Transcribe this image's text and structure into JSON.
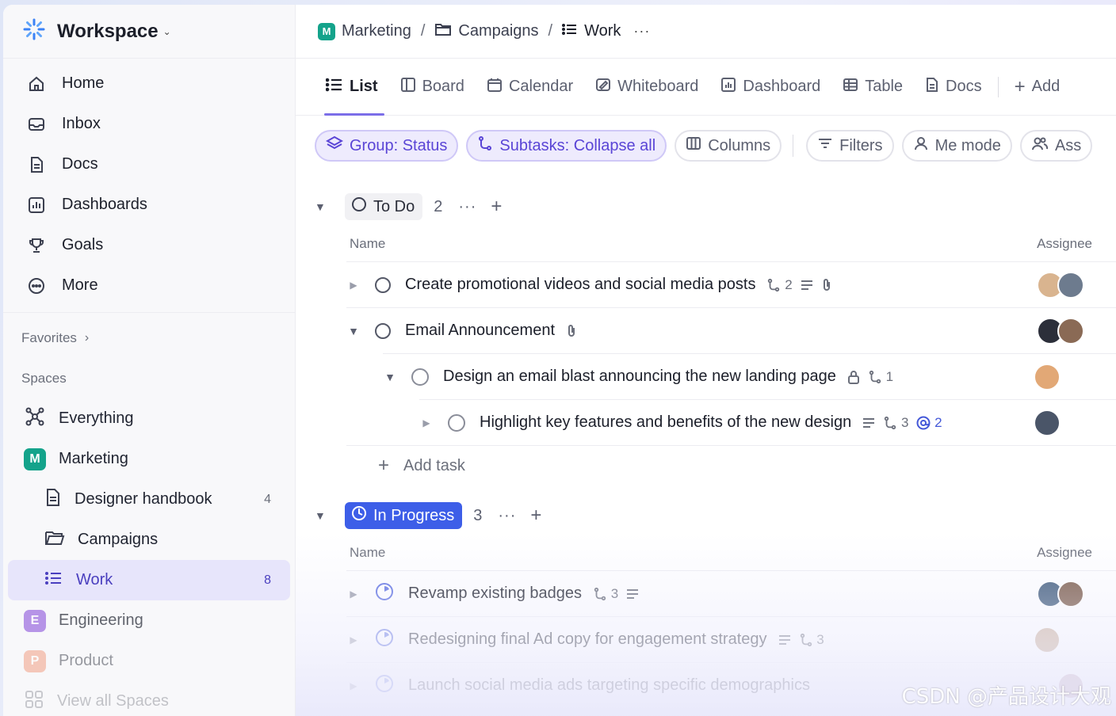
{
  "workspace": {
    "title": "Workspace"
  },
  "nav": [
    {
      "label": "Home",
      "icon": "home-icon"
    },
    {
      "label": "Inbox",
      "icon": "inbox-icon"
    },
    {
      "label": "Docs",
      "icon": "docs-icon"
    },
    {
      "label": "Dashboards",
      "icon": "dashboards-icon"
    },
    {
      "label": "Goals",
      "icon": "trophy-icon"
    },
    {
      "label": "More",
      "icon": "more-icon"
    }
  ],
  "sections": {
    "favorites": "Favorites",
    "spaces": "Spaces"
  },
  "spaces": {
    "everything": "Everything",
    "marketing": {
      "badge": "M",
      "label": "Marketing",
      "color": "#14a38b"
    },
    "designer_handbook": {
      "label": "Designer handbook",
      "count": "4"
    },
    "campaigns": {
      "label": "Campaigns"
    },
    "work": {
      "label": "Work",
      "count": "8"
    },
    "engineering": {
      "badge": "E",
      "label": "Engineering",
      "color": "#9b6be0"
    },
    "product": {
      "badge": "P",
      "label": "Product",
      "color": "#f08c6c"
    },
    "view_all": "View all Spaces"
  },
  "breadcrumb": {
    "space": "Marketing",
    "folder": "Campaigns",
    "list": "Work",
    "space_badge": "M"
  },
  "tabs": [
    "List",
    "Board",
    "Calendar",
    "Whiteboard",
    "Dashboard",
    "Table",
    "Docs",
    "Add"
  ],
  "filters": {
    "group": "Group: Status",
    "subtasks": "Subtasks: Collapse all",
    "columns": "Columns",
    "filters": "Filters",
    "me_mode": "Me mode",
    "assignee": "Ass"
  },
  "columns": {
    "name": "Name",
    "assignee": "Assignee"
  },
  "groups": {
    "todo": {
      "label": "To Do",
      "count": "2",
      "tasks": [
        {
          "name": "Create promotional videos and social media posts",
          "subtasks": "2"
        },
        {
          "name": "Email Announcement"
        },
        {
          "name": "Design an email blast announcing the new landing page",
          "subtasks": "1"
        },
        {
          "name": "Highlight key features and benefits of the new design",
          "subtasks": "3",
          "mentions": "2"
        }
      ],
      "add_task": "Add task"
    },
    "progress": {
      "label": "In Progress",
      "count": "3",
      "tasks": [
        {
          "name": "Revamp existing badges",
          "subtasks": "3"
        },
        {
          "name": "Redesigning final Ad copy for engagement strategy",
          "subtasks": "3"
        },
        {
          "name": "Launch social media ads targeting specific demographics"
        }
      ]
    }
  },
  "watermark": "CSDN @产品设计大观",
  "colors": {
    "accent": "#7b6ee8",
    "progress": "#3d5ee8",
    "marketing": "#14a38b"
  }
}
